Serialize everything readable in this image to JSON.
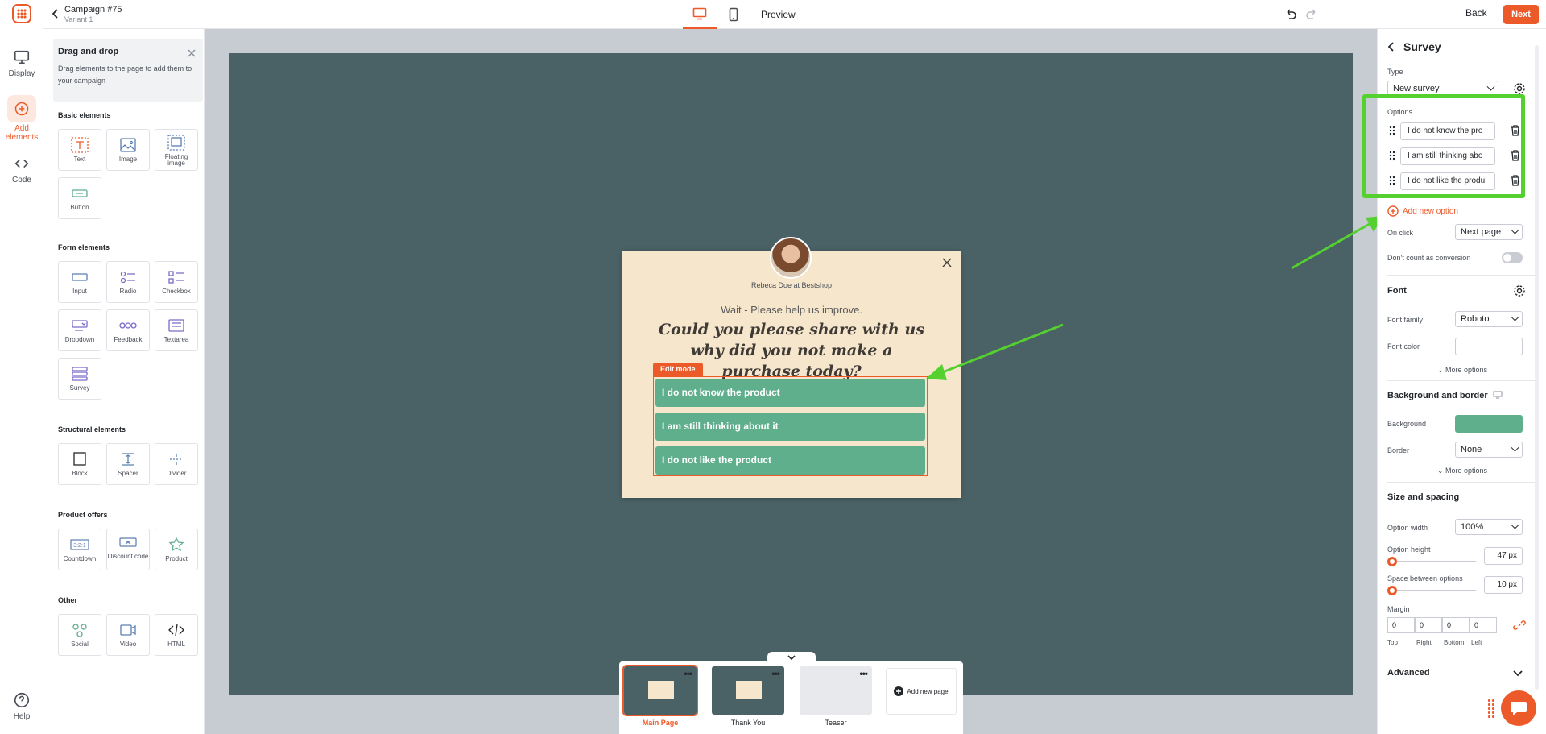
{
  "header": {
    "campaign_title": "Campaign #75",
    "variant": "Variant 1",
    "preview_label": "Preview",
    "back_label": "Back",
    "next_label": "Next"
  },
  "rail": {
    "items": [
      {
        "label": "Display",
        "icon": "monitor-icon"
      },
      {
        "label": "Add elements",
        "icon": "plus-circle-icon"
      },
      {
        "label": "Code",
        "icon": "code-icon"
      },
      {
        "label": "Help",
        "icon": "help-icon"
      }
    ]
  },
  "left_panel": {
    "dd_title": "Drag and drop",
    "dd_desc": "Drag elements to the page to add them to your campaign",
    "sections": {
      "basic": "Basic elements",
      "form": "Form elements",
      "structural": "Structural elements",
      "product": "Product offers",
      "other": "Other"
    },
    "basic": [
      "Text",
      "Image",
      "Floating image",
      "Button"
    ],
    "form": [
      "Input",
      "Radio",
      "Checkbox",
      "Dropdown",
      "Feedback",
      "Textarea",
      "Survey"
    ],
    "structural": [
      "Block",
      "Spacer",
      "Divider"
    ],
    "product": [
      "Countdown",
      "Discount code",
      "Product"
    ],
    "other": [
      "Social",
      "Video",
      "HTML"
    ]
  },
  "popup": {
    "author": "Rebeca Doe at Bestshop",
    "wait": "Wait - Please help us improve.",
    "headline": "Could you please share with us why did you not make a purchase today?",
    "edit_tag": "Edit mode",
    "options": [
      "I do not know the product",
      "I am still thinking about it",
      "I do not like the product"
    ]
  },
  "pages": {
    "items": [
      "Main Page",
      "Thank You",
      "Teaser"
    ],
    "add_label": "Add new page"
  },
  "right_panel": {
    "title": "Survey",
    "type_label": "Type",
    "type_value": "New survey",
    "options_label": "Options",
    "options": [
      "I do not know the pro",
      "I am still thinking abo",
      "I do not like the produ"
    ],
    "add_option": "Add new option",
    "on_click_label": "On click",
    "on_click_value": "Next page",
    "no_conversion_label": "Don't count as conversion",
    "font_section": "Font",
    "font_family_label": "Font family",
    "font_family_value": "Roboto",
    "font_color_label": "Font color",
    "more_options": "More options",
    "bg_section": "Background and border",
    "background_label": "Background",
    "border_label": "Border",
    "border_value": "None",
    "size_section": "Size and spacing",
    "option_width_label": "Option width",
    "option_width_value": "100%",
    "option_height_label": "Option height",
    "option_height_value": "47 px",
    "spacing_label": "Space between options",
    "spacing_value": "10 px",
    "margin_label": "Margin",
    "margins": {
      "top": "0",
      "right": "0",
      "bottom": "0",
      "left": "0"
    },
    "margin_labels": {
      "top": "Top",
      "right": "Right",
      "bottom": "Bottom",
      "left": "Left"
    },
    "advanced_section": "Advanced"
  },
  "colors": {
    "accent": "#ed5a29",
    "option_green": "#5fae8c",
    "highlight_green": "#55d12f",
    "stage_bg": "#4a6266",
    "popup_bg": "#f5e6cc"
  }
}
